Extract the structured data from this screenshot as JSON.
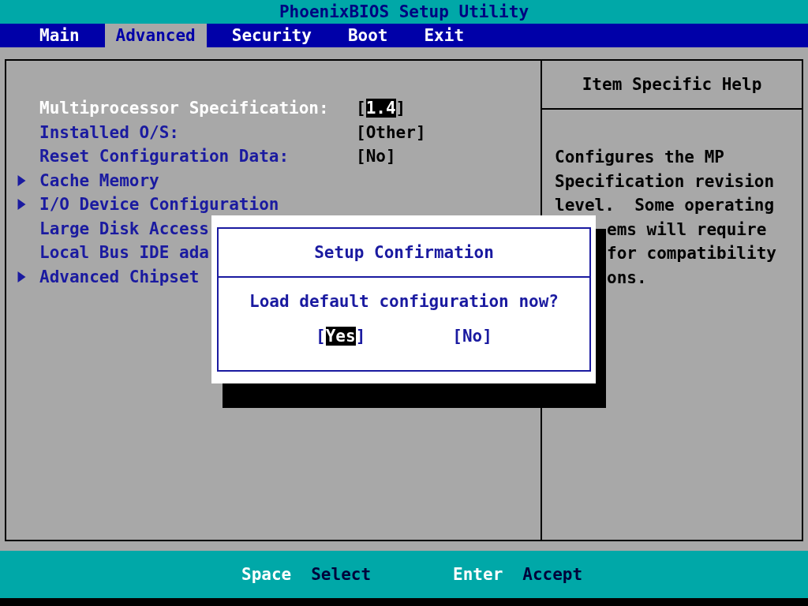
{
  "window": {
    "title": "PhoenixBIOS Setup Utility"
  },
  "tabs": [
    {
      "label": "Main",
      "selected": false
    },
    {
      "label": "Advanced",
      "selected": true
    },
    {
      "label": "Security",
      "selected": false
    },
    {
      "label": "Boot",
      "selected": false
    },
    {
      "label": "Exit",
      "selected": false
    }
  ],
  "items": [
    {
      "label": "Multiprocessor Specification:",
      "selected": true,
      "submenu": false,
      "value_open": "[",
      "value": "1.4",
      "value_close": "]"
    },
    {
      "label": "Installed O/S:",
      "selected": false,
      "submenu": false,
      "value_open": "[",
      "value": "Other",
      "value_close": "]"
    },
    {
      "label": "Reset Configuration Data:",
      "selected": false,
      "submenu": false,
      "value_open": "[",
      "value": "No",
      "value_close": "]"
    },
    {
      "label": "Cache Memory",
      "selected": false,
      "submenu": true
    },
    {
      "label": "I/O Device Configuration",
      "selected": false,
      "submenu": true
    },
    {
      "label": "Large Disk Access",
      "selected": false,
      "submenu": false
    },
    {
      "label": "Local Bus IDE ada",
      "selected": false,
      "submenu": false
    },
    {
      "label": "Advanced Chipset",
      "selected": false,
      "submenu": true
    }
  ],
  "help": {
    "title": "Item Specific Help",
    "lines": [
      "Configures the MP",
      "Specification revision",
      "level.  Some operating",
      "ems will require",
      "for compatibility",
      "ons."
    ]
  },
  "dialog": {
    "title": "Setup Confirmation",
    "message": "Load default configuration now?",
    "buttons": [
      {
        "open": "[",
        "label": "Yes",
        "close": "]",
        "selected": true
      },
      {
        "open": "[",
        "label": "No",
        "close": "]",
        "selected": false
      }
    ]
  },
  "status_bar": [
    {
      "key": "Space",
      "action": "Select"
    },
    {
      "key": "Enter",
      "action": "Accept"
    }
  ]
}
